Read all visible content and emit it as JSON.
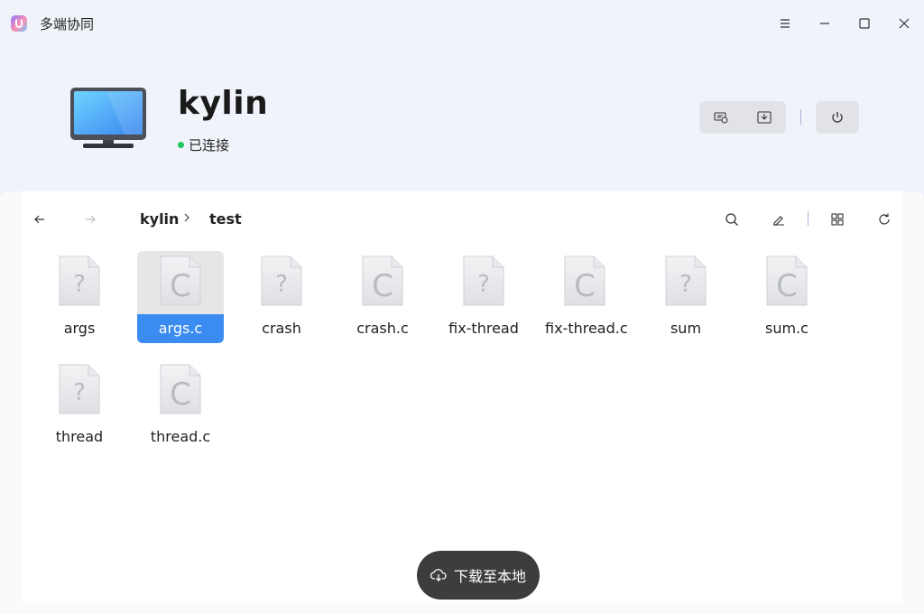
{
  "app": {
    "title": "多端协同"
  },
  "device": {
    "name": "kylin",
    "status": "已连接",
    "status_color": "#22c55e"
  },
  "breadcrumb": {
    "root": "kylin",
    "current": "test"
  },
  "files": [
    {
      "name": "args",
      "type": "unknown"
    },
    {
      "name": "args.c",
      "type": "c",
      "selected": true
    },
    {
      "name": "crash",
      "type": "unknown"
    },
    {
      "name": "crash.c",
      "type": "c"
    },
    {
      "name": "fix-thread",
      "type": "unknown"
    },
    {
      "name": "fix-thread.c",
      "type": "c"
    },
    {
      "name": "sum",
      "type": "unknown"
    },
    {
      "name": "sum.c",
      "type": "c"
    },
    {
      "name": "thread",
      "type": "unknown"
    },
    {
      "name": "thread.c",
      "type": "c"
    }
  ],
  "actions": {
    "download_label": "下载至本地"
  },
  "colors": {
    "accent": "#3b8cf0",
    "header_bg": "#f1f3fb",
    "fab_bg": "#3d3d3d"
  },
  "icons": [
    "menu-icon",
    "minimize-icon",
    "maximize-icon",
    "close-icon",
    "screen-share-icon",
    "download-icon",
    "power-icon",
    "back-arrow-icon",
    "forward-arrow-icon",
    "search-icon",
    "edit-icon",
    "grid-view-icon",
    "refresh-icon",
    "cloud-download-icon"
  ]
}
